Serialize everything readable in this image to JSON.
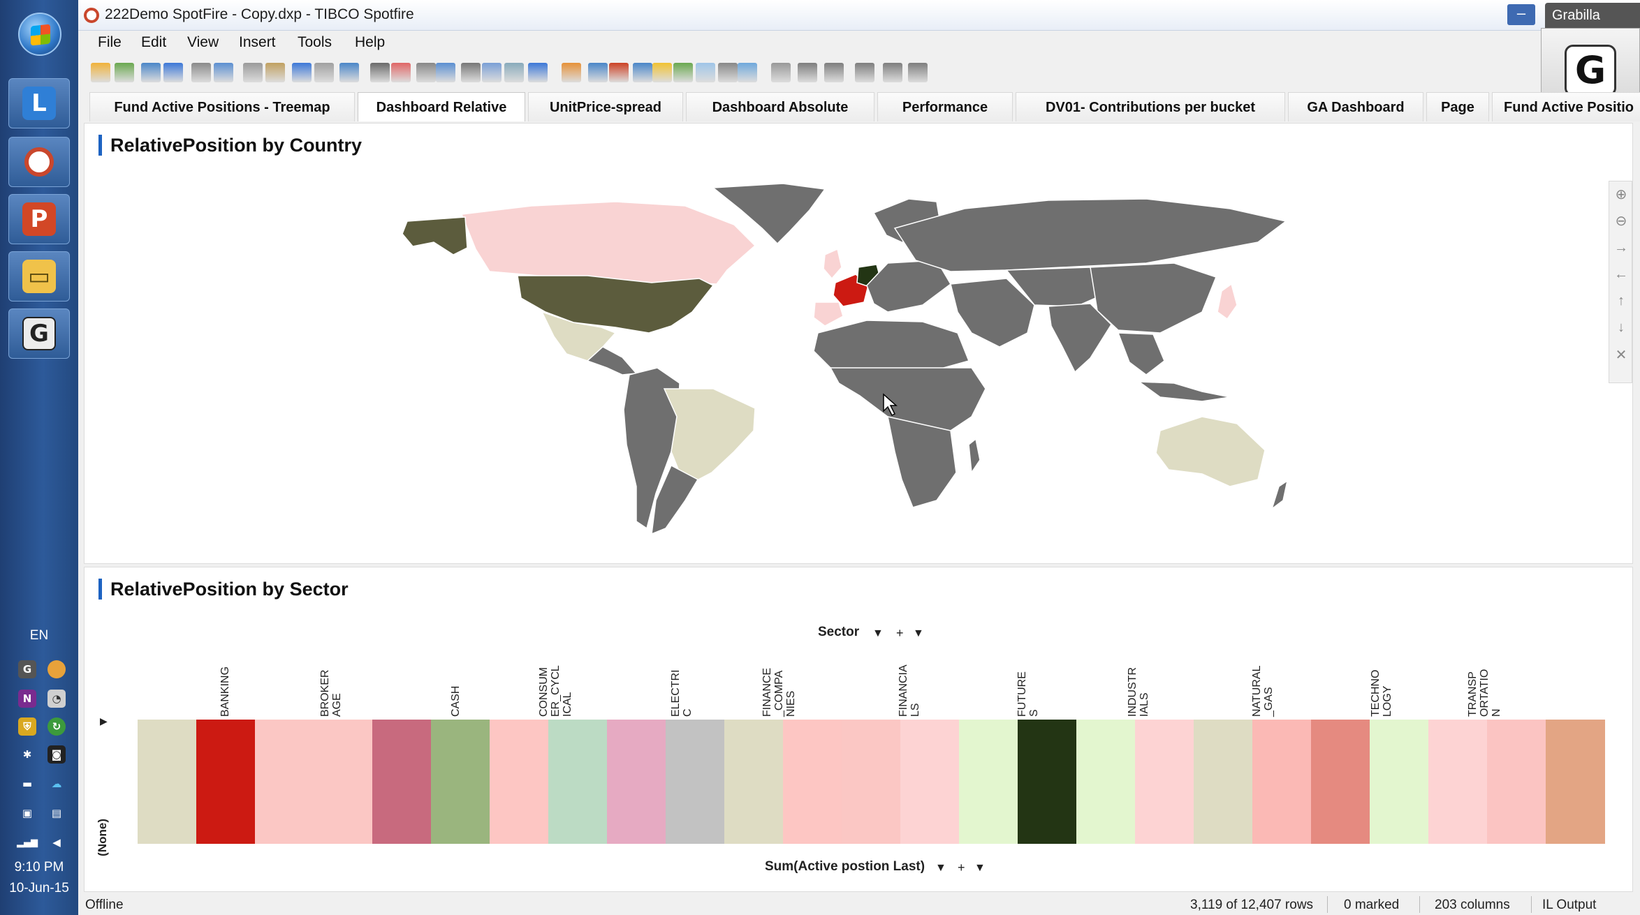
{
  "taskbar": {
    "lang": "EN",
    "time": "9:10 PM",
    "date": "10-Jun-15"
  },
  "window": {
    "title": "222Demo SpotFire - Copy.dxp - TIBCO Spotfire",
    "grabilla_label": "Grabilla",
    "minimize_symbol": "–"
  },
  "menu": [
    "File",
    "Edit",
    "View",
    "Insert",
    "Tools",
    "Help"
  ],
  "tabs": [
    {
      "label": "Fund Active Positions  - Treemap",
      "active": false
    },
    {
      "label": "Dashboard Relative",
      "active": true
    },
    {
      "label": "UnitPrice-spread",
      "active": false
    },
    {
      "label": "Dashboard Absolute",
      "active": false
    },
    {
      "label": "Performance",
      "active": false
    },
    {
      "label": "DV01- Contributions per bucket",
      "active": false
    },
    {
      "label": "GA Dashboard",
      "active": false
    },
    {
      "label": "Page",
      "active": false
    },
    {
      "label": "Fund Active Positio",
      "active": false
    }
  ],
  "map_panel": {
    "title": "RelativePosition by Country",
    "colors": {
      "us": "#5c5c3d",
      "canada": "#f9d3d3",
      "alaska": "#5c5c3d",
      "mexico": "#dedcc3",
      "brazil": "#dedcc3",
      "australia": "#dedcc3",
      "france": "#cc1a12",
      "germany": "#233514",
      "uk": "#f9d3d3",
      "default_land": "#6f6f6f",
      "ocean": "#ffffff"
    },
    "nav_icons": [
      "zoom-in-icon",
      "zoom-out-icon",
      "pan-right-icon",
      "pan-left-icon",
      "pan-up-icon",
      "pan-down-icon",
      "fit-icon"
    ]
  },
  "sector_panel": {
    "title": "RelativePosition by Sector",
    "column_selector": "Sector",
    "axis_selector": "Sum(Active postion Last)",
    "row_label": "(None)",
    "ctrl_dropdown": "▼",
    "ctrl_plus": "+",
    "ctrl_expand": "▶",
    "column_labels": [
      "BANKING",
      "BROKER\nAGE",
      "CASH",
      "CONSUM\nER_CYCL\nICAL",
      "ELECTRI\nC",
      "FINANCE\n_COMPA\nNIES",
      "FINANCIA\nLS",
      "FUTURE\nS",
      "INDUSTR\nIALS",
      "NATURAL\n_GAS",
      "TECHNO\nLOGY",
      "TRANSP\nORTATIO\nN"
    ],
    "cell_colors": [
      "#dedcc3",
      "#cc1a12",
      "#fbc7c4",
      "#fbc7c4",
      "#c86a7e",
      "#9ab57e",
      "#fdc6c3",
      "#bcdbc4",
      "#e6aac2",
      "#c2c2c2",
      "#dedcc3",
      "#fdc6c3",
      "#fbc7c4",
      "#fdd3d3",
      "#e3f6cf",
      "#233514",
      "#e3f6cf",
      "#fdd3d3",
      "#dedcc3",
      "#fbb9b5",
      "#e58a80",
      "#e3f6cf",
      "#fdd3d3",
      "#fbc4c2",
      "#e3a584"
    ]
  },
  "status": {
    "offline": "Offline",
    "rows": "3,119 of 12,407 rows",
    "marked": "0 marked",
    "columns": "203 columns",
    "output": "IL Output"
  }
}
